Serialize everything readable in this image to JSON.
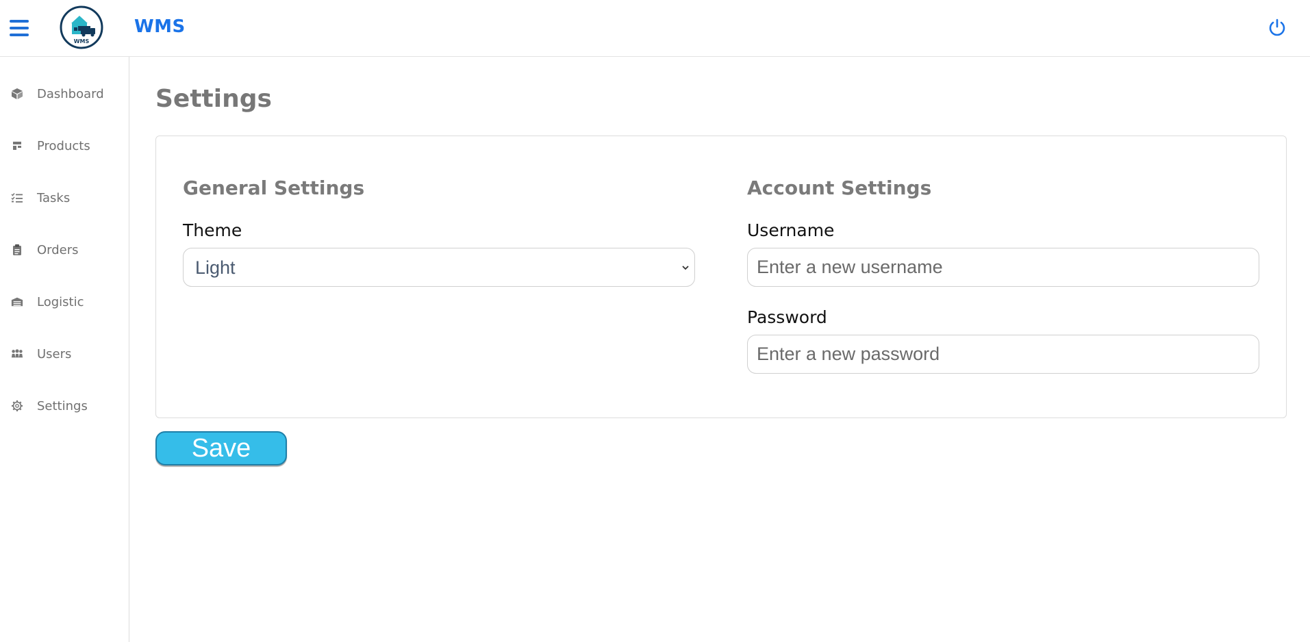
{
  "app": {
    "title": "WMS",
    "logo_text": "WMS",
    "accent_color": "#1a73e8"
  },
  "header": {
    "menu_icon": "hamburger-icon",
    "power_icon": "power-icon"
  },
  "sidebar": {
    "items": [
      {
        "label": "Dashboard",
        "icon": "box-icon"
      },
      {
        "label": "Products",
        "icon": "layout-icon"
      },
      {
        "label": "Tasks",
        "icon": "checklist-icon"
      },
      {
        "label": "Orders",
        "icon": "clipboard-icon"
      },
      {
        "label": "Logistic",
        "icon": "warehouse-icon"
      },
      {
        "label": "Users",
        "icon": "users-icon"
      },
      {
        "label": "Settings",
        "icon": "gear-icon"
      }
    ]
  },
  "page": {
    "title": "Settings"
  },
  "general": {
    "title": "General Settings",
    "theme_label": "Theme",
    "theme_value": "Light"
  },
  "account": {
    "title": "Account Settings",
    "username_label": "Username",
    "username_placeholder": "Enter a new username",
    "password_label": "Password",
    "password_placeholder": "Enter a new password"
  },
  "actions": {
    "save_label": "Save",
    "save_color": "#35bde9"
  }
}
